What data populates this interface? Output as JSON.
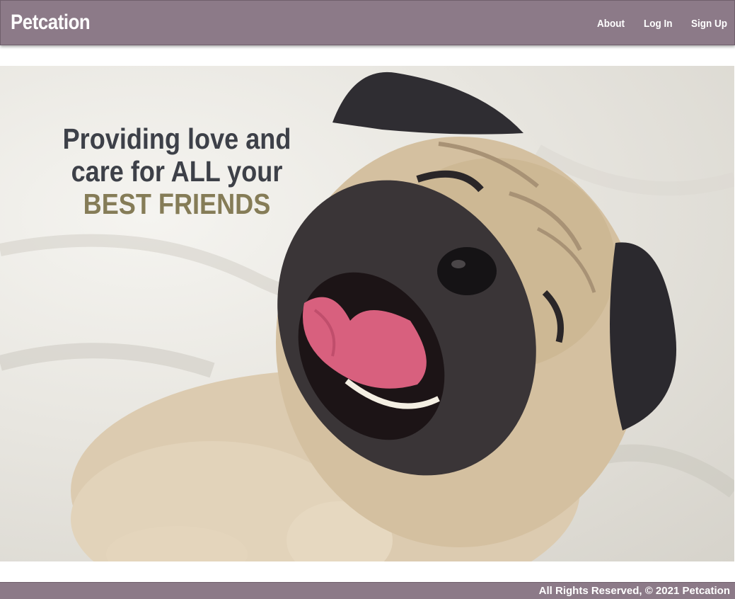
{
  "navbar": {
    "brand": "Petcation",
    "links": [
      "About",
      "Log In",
      "Sign Up"
    ]
  },
  "hero": {
    "headline_line1": "Providing love and",
    "headline_line2": "care for ALL your",
    "headline_accent": "BEST FRIENDS",
    "image_subject": "smiling pug lying on a white blanket"
  },
  "footer": {
    "copyright": "All Rights Reserved, © 2021 Petcation"
  },
  "colors": {
    "navbar_bg": "#8c7a88",
    "heading_text": "#3d4048",
    "accent_text": "#857c57"
  }
}
